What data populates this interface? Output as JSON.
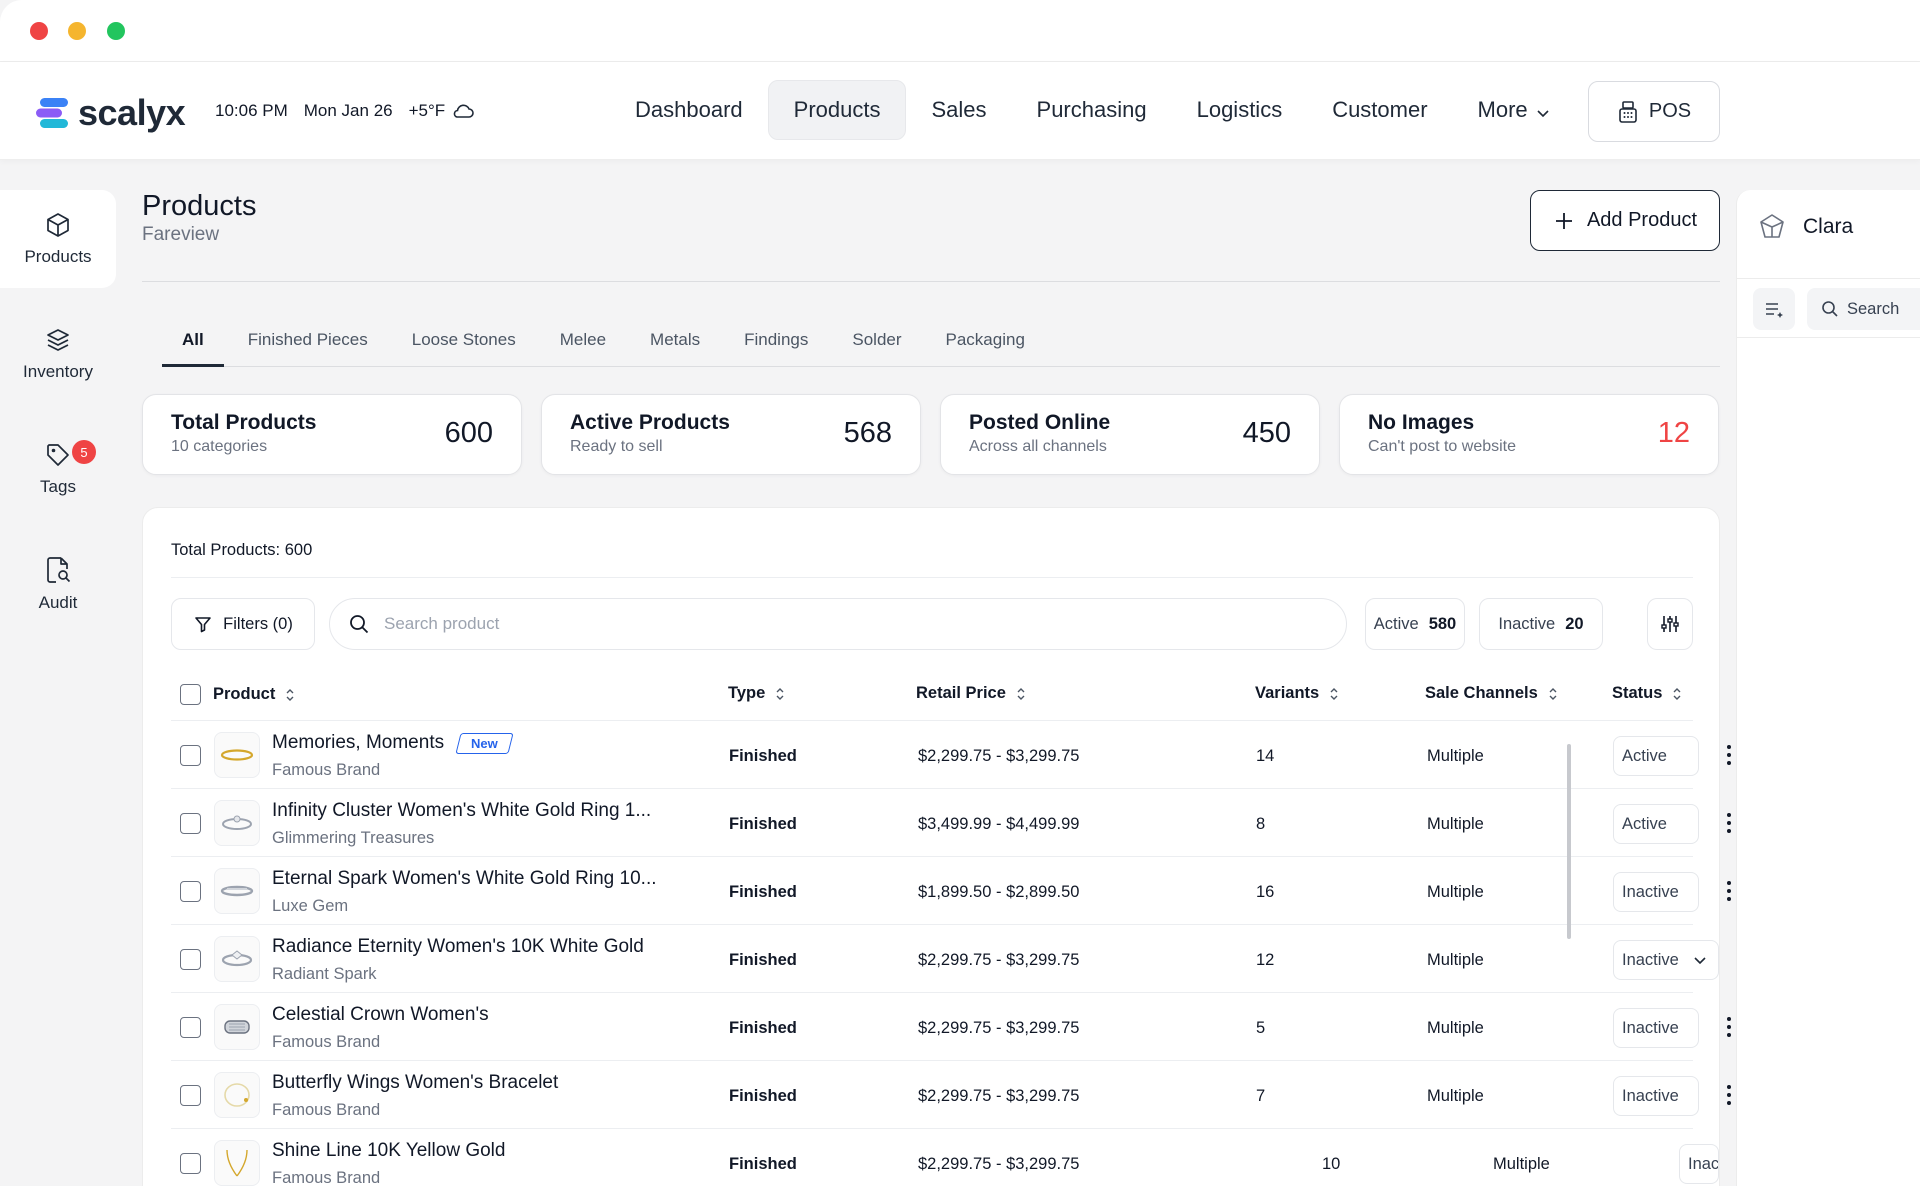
{
  "window": {
    "controls": {
      "close_color": "#ef4444",
      "minimize_color": "#f5b52e",
      "maximize_color": "#22c55e"
    }
  },
  "header": {
    "logo_text": "scalyx",
    "time": "10:06 PM",
    "date": "Mon Jan 26",
    "weather": "+5°F",
    "weather_icon": "cloud-icon",
    "nav": [
      "Dashboard",
      "Products",
      "Sales",
      "Purchasing",
      "Logistics",
      "Customer",
      "More"
    ],
    "active_nav": "Products",
    "pos_label": "POS"
  },
  "sidebar": {
    "items": [
      {
        "label": "Products",
        "icon": "cube-icon",
        "active": true
      },
      {
        "label": "Inventory",
        "icon": "layers-icon",
        "active": false
      },
      {
        "label": "Tags",
        "icon": "tag-icon",
        "active": false,
        "badge": "5"
      },
      {
        "label": "Audit",
        "icon": "file-search-icon",
        "active": false
      }
    ]
  },
  "page": {
    "title": "Products",
    "subtitle": "Fareview",
    "add_button": "Add Product"
  },
  "tabs": [
    "All",
    "Finished Pieces",
    "Loose Stones",
    "Melee",
    "Metals",
    "Findings",
    "Solder",
    "Packaging"
  ],
  "active_tab": "All",
  "stats": [
    {
      "title": "Total Products",
      "subtitle": "10 categories",
      "value": "600"
    },
    {
      "title": "Active Products",
      "subtitle": "Ready to sell",
      "value": "568"
    },
    {
      "title": "Posted Online",
      "subtitle": "Across all channels",
      "value": "450"
    },
    {
      "title": "No Images",
      "subtitle": "Can't post to website",
      "value": "12",
      "color": "#ef4444"
    }
  ],
  "table": {
    "total_label": "Total Products: 600",
    "filters_label": "Filters (0)",
    "search_placeholder": "Search product",
    "active_label": "Active",
    "active_count": "580",
    "inactive_label": "Inactive",
    "inactive_count": "20",
    "columns": [
      "Product",
      "Type",
      "Retail Price",
      "Variants",
      "Sale Channels",
      "Status"
    ],
    "rows": [
      {
        "name": "Memories, Moments",
        "tag": "New",
        "brand": "Famous Brand",
        "type": "Finished",
        "price": "$2,299.75 - $3,299.75",
        "variants": "14",
        "channels": "Multiple",
        "status": "Active"
      },
      {
        "name": "Infinity Cluster Women's White Gold Ring 1...",
        "brand": "Glimmering Treasures",
        "type": "Finished",
        "price": "$3,499.99 - $4,499.99",
        "variants": "8",
        "channels": "Multiple",
        "status": "Active"
      },
      {
        "name": "Eternal Spark Women's White Gold Ring 10...",
        "brand": "Luxe Gem",
        "type": "Finished",
        "price": "$1,899.50 - $2,899.50",
        "variants": "16",
        "channels": "Multiple",
        "status": "Inactive"
      },
      {
        "name": "Radiance Eternity Women's 10K White Gold",
        "brand": "Radiant Spark",
        "type": "Finished",
        "price": "$2,299.75 - $3,299.75",
        "variants": "12",
        "channels": "Multiple",
        "status": "Inactive"
      },
      {
        "name": "Celestial Crown Women's",
        "brand": "Famous Brand",
        "type": "Finished",
        "price": "$2,299.75 - $3,299.75",
        "variants": "5",
        "channels": "Multiple",
        "status": "Inactive"
      },
      {
        "name": "Butterfly Wings Women's Bracelet",
        "brand": "Famous Brand",
        "type": "Finished",
        "price": "$2,299.75 - $3,299.75",
        "variants": "7",
        "channels": "Multiple",
        "status": "Inactive"
      },
      {
        "name": "Shine Line 10K Yellow Gold",
        "brand": "Famous Brand",
        "type": "Finished",
        "price": "$2,299.75 - $3,299.75",
        "variants": "10",
        "channels": "Multiple",
        "status": "Inac"
      }
    ]
  },
  "assistant": {
    "name": "Clara",
    "search_label": "Search"
  }
}
